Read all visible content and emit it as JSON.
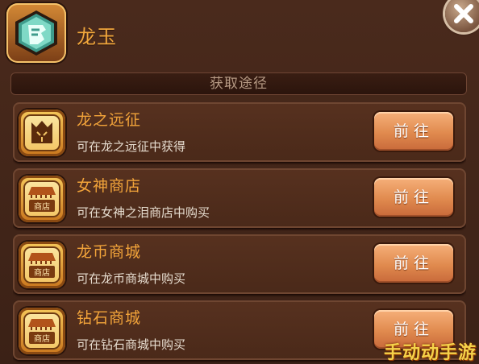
{
  "header": {
    "item_name": "龙玉"
  },
  "section": {
    "title": "获取途径"
  },
  "sources": [
    {
      "title": "龙之远征",
      "desc": "可在龙之远征中获得",
      "button": "前往",
      "icon": "dragon-expedition-icon"
    },
    {
      "title": "女神商店",
      "desc": "可在女神之泪商店中购买",
      "button": "前往",
      "icon": "shop-icon"
    },
    {
      "title": "龙币商城",
      "desc": "可在龙币商城中购买",
      "button": "前往",
      "icon": "shop-icon"
    },
    {
      "title": "钻石商城",
      "desc": "可在钻石商城中购买",
      "button": "前往",
      "icon": "shop-icon"
    }
  ],
  "shop_icon_text": "商店",
  "watermark": "手动动手游"
}
